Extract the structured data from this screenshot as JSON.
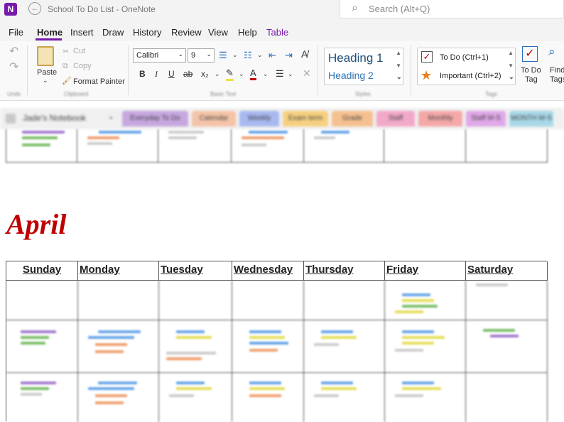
{
  "titlebar": {
    "title": "School To Do List  -  OneNote",
    "logo": "N",
    "search_placeholder": "Search (Alt+Q)"
  },
  "menu": {
    "items": [
      "File",
      "Home",
      "Insert",
      "Draw",
      "History",
      "Review",
      "View",
      "Help",
      "Table"
    ],
    "active": "Home"
  },
  "ribbon": {
    "paste": "Paste",
    "cut": "Cut",
    "copy": "Copy",
    "format_painter": "Format Painter",
    "font": "Calibri",
    "font_size": "9",
    "heading1": "Heading 1",
    "heading2": "Heading 2",
    "todo": "To Do (Ctrl+1)",
    "important": "Important (Ctrl+2)",
    "todo_tag_1": "To Do",
    "todo_tag_2": "Tag",
    "find_tags_1": "Find",
    "find_tags_2": "Tags",
    "group_basic_text": "Basic Text",
    "group_clipboard": "Clipboard",
    "group_styles": "Styles",
    "group_tags": "Tags",
    "group_undo": "Undo"
  },
  "notebook": {
    "name": "Jade's Notebook",
    "sections": [
      "Everyday To Do",
      "Calendar",
      "Weekly",
      "Exam term",
      "Grade",
      "Staff",
      "Monthly",
      "Staff M-S",
      "MONTH M-S"
    ]
  },
  "calendar": {
    "month": "April",
    "days": [
      "Sunday",
      "Monday",
      "Tuesday",
      "Wednesday",
      "Thursday",
      "Friday",
      "Saturday"
    ]
  },
  "colors": {
    "accent": "#7719aa",
    "month_title": "#c00000",
    "bar_blue": "#6aa6e8",
    "bar_green": "#7cbf6a",
    "bar_yellow": "#e6de5a",
    "bar_orange": "#f0a070",
    "bar_purple": "#a47bd0"
  }
}
